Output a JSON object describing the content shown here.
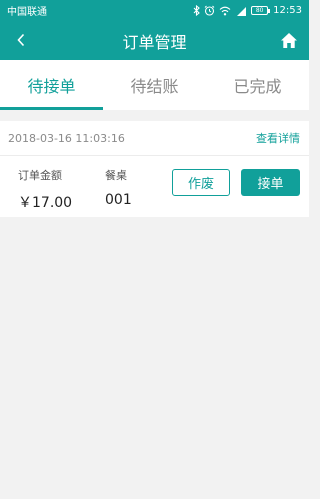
{
  "status_bar": {
    "carrier": "中国联通",
    "battery": "80",
    "time": "12:53",
    "icons": [
      "bluetooth-icon",
      "alarm-icon",
      "wifi-icon",
      "signal-icon",
      "battery-icon"
    ]
  },
  "header": {
    "title": "订单管理",
    "back_icon": "back-icon",
    "home_icon": "home-icon"
  },
  "tabs": [
    {
      "label": "待接单",
      "active": true
    },
    {
      "label": "待结账",
      "active": false
    },
    {
      "label": "已完成",
      "active": false
    }
  ],
  "order": {
    "datetime": "2018-03-16 11:03:16",
    "detail_label": "查看详情",
    "amount_label": "订单金额",
    "amount_value": "￥17.00",
    "table_label": "餐桌",
    "table_value": "001",
    "void_label": "作废",
    "accept_label": "接单"
  },
  "colors": {
    "accent": "#11a09a",
    "background": "#f2f2f2"
  }
}
